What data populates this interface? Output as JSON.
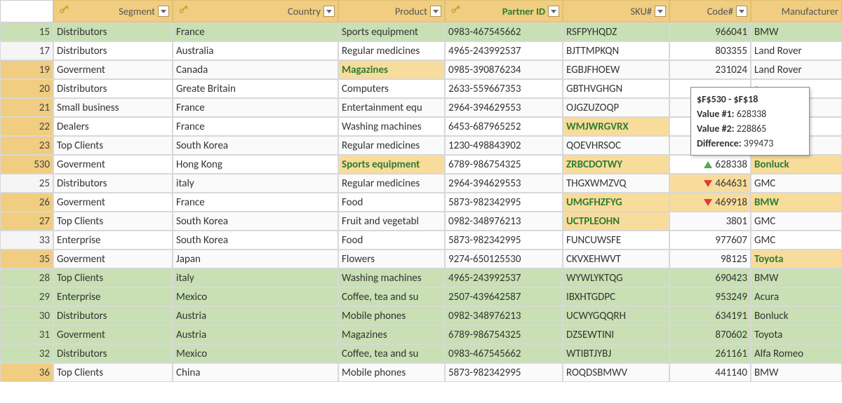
{
  "columns": {
    "segment": "Segment",
    "country": "Country",
    "product": "Product",
    "partner_id": "Partner ID",
    "sku": "SKU#",
    "code": "Code#",
    "manufacturer": "Manufacturer"
  },
  "rows": [
    {
      "n": "15",
      "seg": "Distributors",
      "cty": "France",
      "prd": "Sports equipment",
      "pid": "0983-467545662",
      "sku": "RSFPYHQDZ",
      "code": "966041",
      "mfr": "BMW",
      "rnbg": "green",
      "rowbg": "green"
    },
    {
      "n": "17",
      "seg": "Distributors",
      "cty": "Australia",
      "prd": "Regular medicines",
      "pid": "4965-243992537",
      "sku": "BJTTMPKQN",
      "code": "803355",
      "mfr": "Land Rover",
      "rowbg": "white"
    },
    {
      "n": "19",
      "seg": "Goverment",
      "cty": "Canada",
      "prd": "Magazines",
      "pid": "0985-390876234",
      "sku": "EGBJFHOEW",
      "code": "231024",
      "mfr": "Land Rover",
      "rnbg": "orange",
      "rowbg": "light",
      "prd_hl": true
    },
    {
      "n": "20",
      "seg": "Distributors",
      "cty": "Greate Britain",
      "prd": "Computers",
      "pid": "2633-559667353",
      "sku": "GBTHVGHGN",
      "code": "",
      "mfr": "r",
      "rnbg": "orange",
      "rowbg": "white"
    },
    {
      "n": "21",
      "seg": "Small business",
      "cty": "France",
      "prd": "Entertainment equ",
      "pid": "2964-394629553",
      "sku": "OJGZUZOQP",
      "code": "",
      "mfr": "",
      "rnbg": "orange",
      "rowbg": "light"
    },
    {
      "n": "22",
      "seg": "Dealers",
      "cty": "France",
      "prd": "Washing machines",
      "pid": "6453-687965252",
      "sku": "WMJWRGVRX",
      "code": "",
      "mfr": "",
      "rnbg": "orange",
      "rowbg": "white",
      "sku_hl": true
    },
    {
      "n": "23",
      "seg": "Top Clients",
      "cty": "South Korea",
      "prd": "Regular medicines",
      "pid": "1230-498843902",
      "sku": "QOEVHRSOC",
      "code": "",
      "mfr": "",
      "rnbg": "orange",
      "rowbg": "light"
    },
    {
      "n": "530",
      "seg": "Goverment",
      "cty": "Hong Kong",
      "prd": "Sports equipment",
      "pid": "6789-986754325",
      "sku": "ZRBCDOTWY",
      "code": "628338",
      "mfr": "Bonluck",
      "rnbg": "orange",
      "rowbg": "white",
      "prd_hl": true,
      "sku_hl": true,
      "ind": "up",
      "mfr_hl": true
    },
    {
      "n": "25",
      "seg": "Distributors",
      "cty": "italy",
      "prd": "Regular medicines",
      "pid": "2964-394629553",
      "sku": "THGXWMZVQ",
      "code": "464631",
      "mfr": "GMC",
      "rowbg": "light",
      "ind": "down",
      "code_hl": true
    },
    {
      "n": "26",
      "seg": "Goverment",
      "cty": "France",
      "prd": "Food",
      "pid": "5873-982342995",
      "sku": "UMGFHZFYG",
      "code": "469918",
      "mfr": "BMW",
      "rnbg": "orange",
      "rowbg": "white",
      "sku_hl": true,
      "ind": "down",
      "code_hl": true,
      "mfr_hl": true
    },
    {
      "n": "27",
      "seg": "Top Clients",
      "cty": "South Korea",
      "prd": "Fruit and vegetabl",
      "pid": "0982-348976213",
      "sku": "UCTPLEOHN",
      "code": "3801",
      "mfr": "GMC",
      "rnbg": "orange",
      "rowbg": "light",
      "sku_hl": true
    },
    {
      "n": "33",
      "seg": "Enterprise",
      "cty": "South Korea",
      "prd": "Food",
      "pid": "5873-982342995",
      "sku": "FUNCUWSFE",
      "code": "977607",
      "mfr": "GMC",
      "rowbg": "white"
    },
    {
      "n": "35",
      "seg": "Goverment",
      "cty": "Japan",
      "prd": "Flowers",
      "pid": "9274-650125530",
      "sku": "CKVXEHWVT",
      "code": "98125",
      "mfr": "Toyota",
      "rnbg": "orange",
      "rowbg": "light",
      "mfr_hl": true
    },
    {
      "n": "28",
      "seg": "Top Clients",
      "cty": "italy",
      "prd": "Washing machines",
      "pid": "4965-243992537",
      "sku": "WYWLYKTQG",
      "code": "690423",
      "mfr": "BMW",
      "rnbg": "green",
      "rowbg": "green"
    },
    {
      "n": "29",
      "seg": "Enterprise",
      "cty": "Mexico",
      "prd": "Coffee, tea and su",
      "pid": "2507-439642587",
      "sku": "IBXHTGDPC",
      "code": "953249",
      "mfr": "Acura",
      "rnbg": "green",
      "rowbg": "green"
    },
    {
      "n": "30",
      "seg": "Distributors",
      "cty": "Austria",
      "prd": "Mobile phones",
      "pid": "0982-348976213",
      "sku": "UCWYGQQRH",
      "code": "634191",
      "mfr": "Bonluck",
      "rnbg": "green",
      "rowbg": "green"
    },
    {
      "n": "31",
      "seg": "Goverment",
      "cty": "Austria",
      "prd": "Magazines",
      "pid": "6789-986754325",
      "sku": "DZSEWTINI",
      "code": "870602",
      "mfr": "Toyota",
      "rnbg": "green",
      "rowbg": "green"
    },
    {
      "n": "32",
      "seg": "Distributors",
      "cty": "Mexico",
      "prd": "Coffee, tea and su",
      "pid": "0983-467545662",
      "sku": "WTIBTJYBJ",
      "code": "261161",
      "mfr": "Alfa Romeo",
      "rnbg": "green",
      "rowbg": "green"
    },
    {
      "n": "36",
      "seg": "Top Clients",
      "cty": "China",
      "prd": "Mobile phones",
      "pid": "5873-982342995",
      "sku": "ROQDSBMWV",
      "code": "441140",
      "mfr": "BMW",
      "rnbg": "orange",
      "rowbg": "light"
    }
  ],
  "tooltip": {
    "title": "$F$530 - $F$18",
    "l1": "Value #1:",
    "v1": "628338",
    "l2": "Value #2:",
    "v2": "228865",
    "l3": "Difference:",
    "v3": "399473"
  }
}
